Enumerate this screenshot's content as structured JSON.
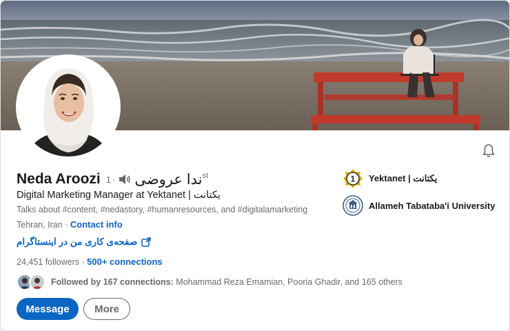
{
  "profile": {
    "name": "Neda Aroozi",
    "degree": "1",
    "name_native": "ندا عروضی",
    "name_suffix": "st",
    "headline": "Digital Marketing Manager at Yektanet | یکتانت",
    "talks_about": "Talks about #content, #nedastory, #humanresources, and #digitalamarketing",
    "location": "Tehran, Iran",
    "location_separator": "·",
    "contact_label": "Contact info",
    "website_label": "صفحه‌ی کاری من در اینستاگرام",
    "followers": "24,451 followers",
    "connections": "500+ connections",
    "followed_prefix": "Followed by 167 connections:",
    "followed_names": " Mohammad Reza Emamian, Pooria Ghadir, and 165 others"
  },
  "actions": {
    "message_label": "Message",
    "more_label": "More"
  },
  "experience": [
    {
      "label": "Yektanet | یکتانت",
      "icon": "yektanet-logo-icon"
    },
    {
      "label": "Allameh Tabataba'i University",
      "icon": "university-seal-icon"
    }
  ],
  "colors": {
    "accent": "#0a66c2",
    "text_primary": "#191919",
    "text_secondary": "#666666",
    "table_red": "#c0392b",
    "logo_gold": "#e2b100"
  },
  "icons": {
    "bell": "bell-icon",
    "speaker": "speaker-icon",
    "external_link": "external-link-icon"
  }
}
